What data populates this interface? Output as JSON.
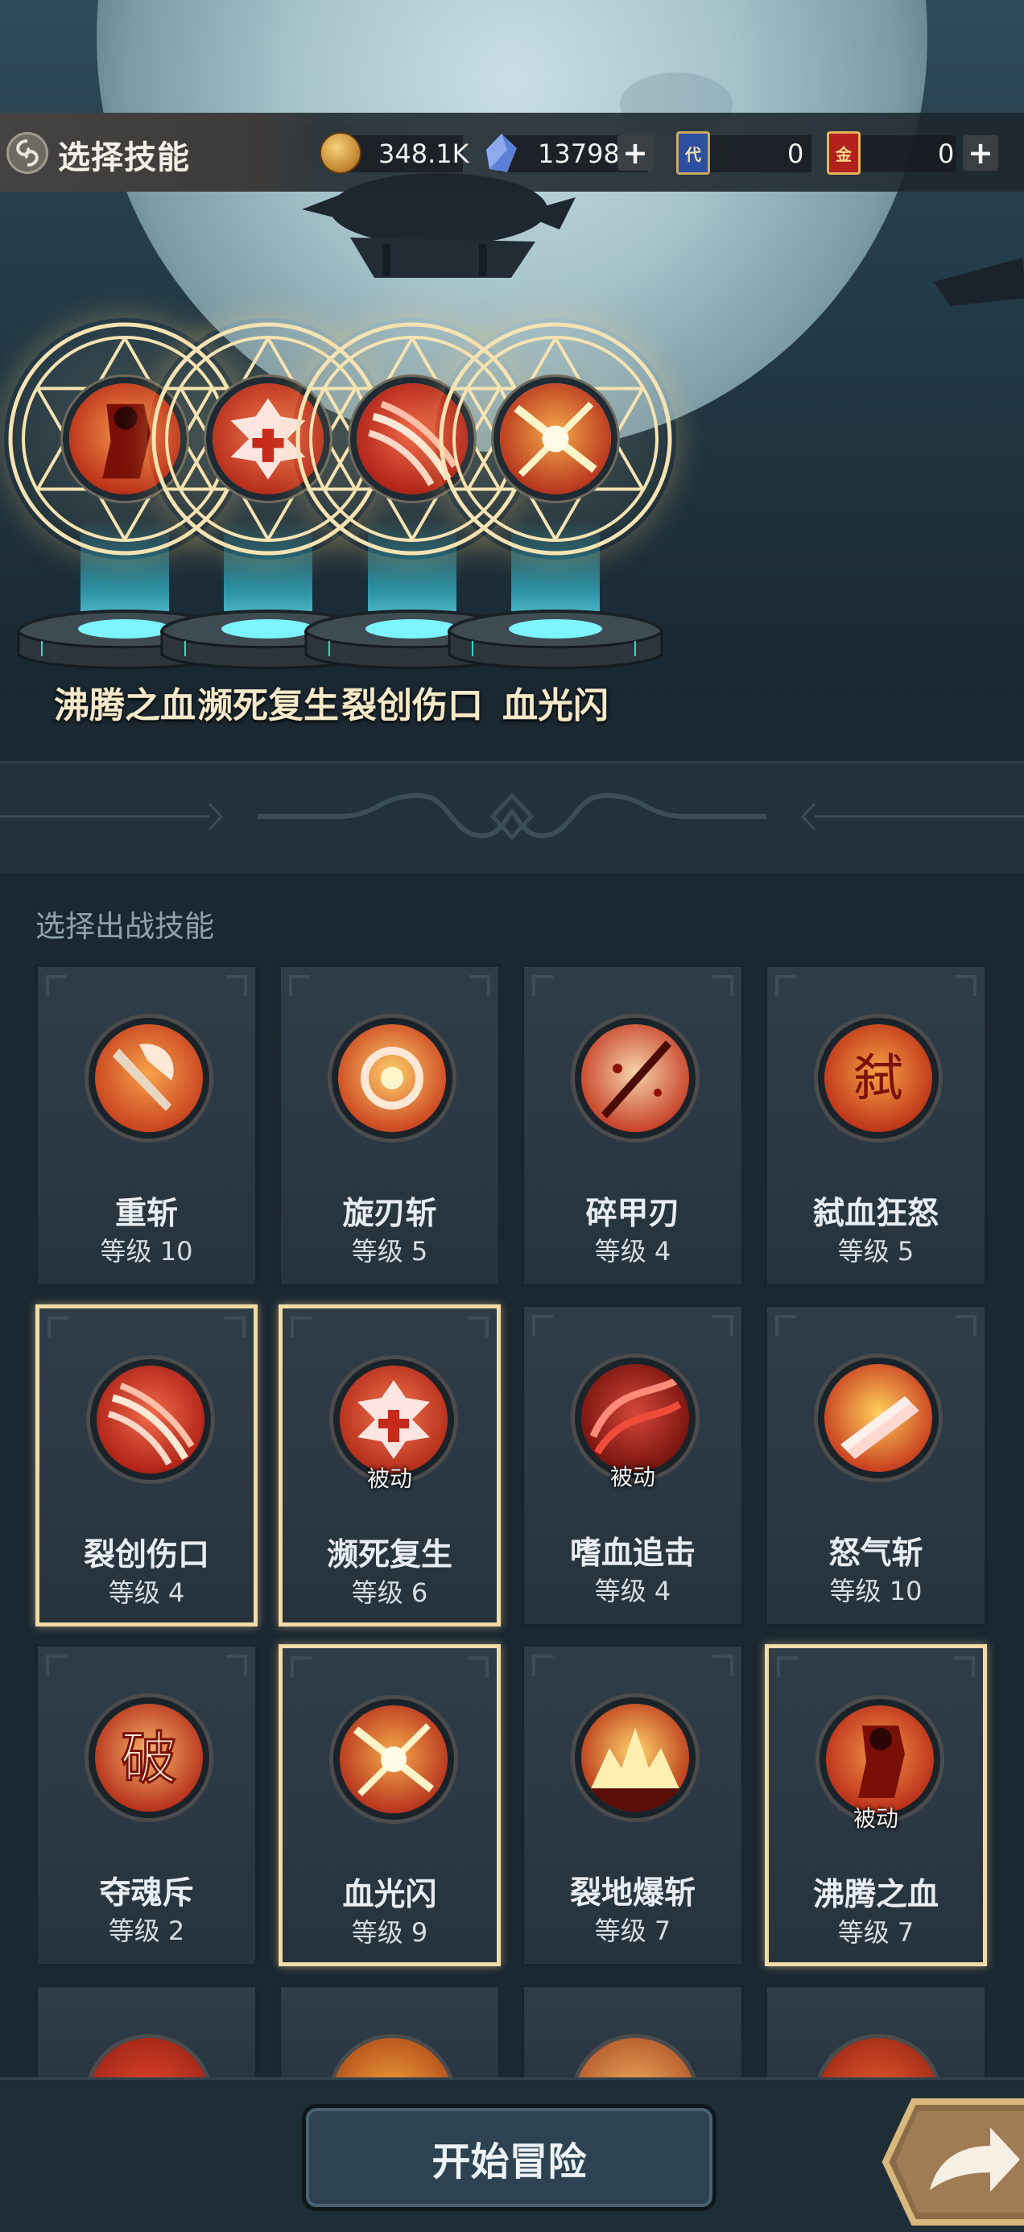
{
  "header": {
    "title": "选择技能",
    "gold": "348.1K",
    "gems": "13798",
    "card_a_label": "代",
    "card_a_count": "0",
    "card_b_label": "金",
    "card_b_count": "0"
  },
  "selected_slots": [
    {
      "name": "沸腾之血",
      "icon": "blood-figure-icon"
    },
    {
      "name": "濒死复生",
      "icon": "revive-cross-icon"
    },
    {
      "name": "裂创伤口",
      "icon": "claw-slash-icon"
    },
    {
      "name": "血光闪",
      "icon": "flash-spark-icon"
    }
  ],
  "section_title": "选择出战技能",
  "skills": [
    {
      "name": "重斩",
      "level": "等级 10",
      "icon": "axe-icon"
    },
    {
      "name": "旋刃斩",
      "level": "等级 5",
      "icon": "whirl-blade-icon"
    },
    {
      "name": "碎甲刃",
      "level": "等级 4",
      "icon": "blade-break-icon"
    },
    {
      "name": "弑血狂怒",
      "level": "等级 5",
      "icon": "rage-rune-icon"
    },
    {
      "name": "裂创伤口",
      "level": "等级 4",
      "icon": "claw-slash-icon",
      "selected": true
    },
    {
      "name": "濒死复生",
      "level": "等级 6",
      "icon": "revive-cross-icon",
      "selected": true,
      "tag": "被动"
    },
    {
      "name": "嗜血追击",
      "level": "等级 4",
      "icon": "blood-chase-icon",
      "tag": "被动"
    },
    {
      "name": "怒气斩",
      "level": "等级 10",
      "icon": "rage-slash-icon"
    },
    {
      "name": "夺魂斥",
      "level": "等级 2",
      "icon": "soul-rune-icon"
    },
    {
      "name": "血光闪",
      "level": "等级 9",
      "icon": "flash-spark-icon",
      "selected": true
    },
    {
      "name": "裂地爆斩",
      "level": "等级 7",
      "icon": "ground-burst-icon"
    },
    {
      "name": "沸腾之血",
      "level": "等级 7",
      "icon": "blood-figure-icon",
      "selected": true,
      "tag": "被动"
    }
  ],
  "footer": {
    "start_label": "开始冒险",
    "next_icon": "arrow-right-icon"
  }
}
